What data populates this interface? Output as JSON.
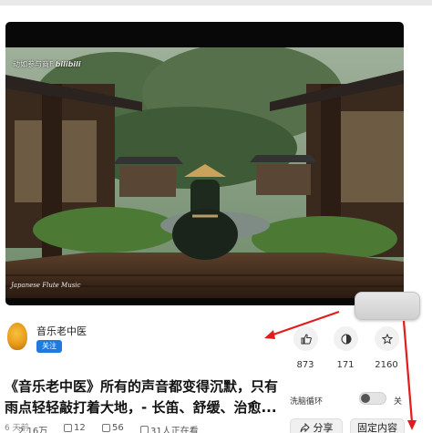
{
  "video": {
    "watermark_top": "动如参与商F",
    "watermark_logo": "bilibili",
    "watermark_bottom": "Japanese Flute Music"
  },
  "channel": {
    "name": "音乐老中医",
    "follow_label": "关注"
  },
  "actions": {
    "like_count": "873",
    "coin_count": "171",
    "favorite_count": "2160"
  },
  "video_title": "《音乐老中医》所有的声音都变得沉默，只有\n雨点轻轻敲打着大地，- 长笛、舒缓、治愈...",
  "posted": "6 天前",
  "loop": {
    "label": "洗脑循环",
    "state": "关"
  },
  "stats": {
    "views": "2.16万",
    "danmaku": "12",
    "comments": "56",
    "watching": "31人正在看"
  },
  "buttons": {
    "share": "分享",
    "pin": "固定内容"
  },
  "colors": {
    "accent": "#1f7ae0",
    "annotation": "#e31b1b"
  }
}
